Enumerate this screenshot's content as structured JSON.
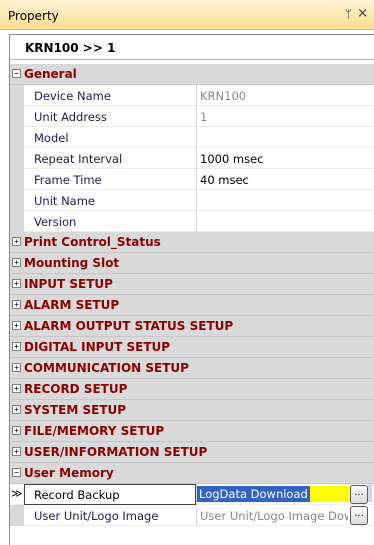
{
  "window": {
    "title": "Property",
    "pin_icon": "pin-icon",
    "close_icon": "close-icon",
    "pin_glyph": "ᛘ",
    "close_glyph": "×"
  },
  "header": {
    "text": "KRN100 >> 1"
  },
  "categories": {
    "general": {
      "label": "General",
      "expanded": true,
      "properties": [
        {
          "name": "Device Name",
          "value": "KRN100"
        },
        {
          "name": "Unit Address",
          "value": "1"
        },
        {
          "name": "Model",
          "value": ""
        },
        {
          "name": "Repeat Interval",
          "value": "1000 msec"
        },
        {
          "name": "Frame Time",
          "value": "40 msec"
        },
        {
          "name": "Unit Name",
          "value": ""
        },
        {
          "name": "Version",
          "value": ""
        }
      ]
    },
    "collapsed": [
      "Print Control_Status",
      "Mounting Slot",
      "INPUT SETUP",
      "ALARM SETUP",
      "ALARM OUTPUT STATUS SETUP",
      "DIGITAL INPUT SETUP",
      "COMMUNICATION SETUP",
      "RECORD SETUP",
      "SYSTEM SETUP",
      "FILE/MEMORY SETUP",
      "USER/INFORMATION SETUP"
    ],
    "user_memory": {
      "label": "User Memory",
      "expanded": true,
      "properties": [
        {
          "name": "Record Backup",
          "value": "LogData Download",
          "selected": true
        },
        {
          "name": "User Unit/Logo Image",
          "value": "User Unit/Logo Image Dow"
        }
      ]
    }
  },
  "toggles": {
    "expanded": "−",
    "collapsed": "+"
  },
  "selection_marker": "≫",
  "ellipsis_label": "...",
  "colors": {
    "category_text": "#8b0000",
    "title_gradient_top": "#fff4d4",
    "title_gradient_bottom": "#f9dc8e",
    "selection_fill": "#3163c5",
    "selection_highlight": "#ffff00"
  }
}
